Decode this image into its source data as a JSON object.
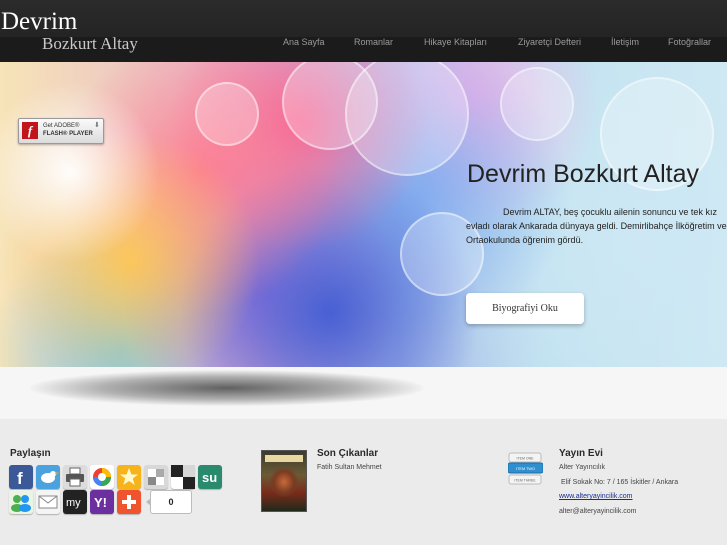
{
  "header": {
    "logo_line1": "Devrim",
    "logo_line2": "Bozkurt Altay",
    "nav": [
      "Ana Sayfa",
      "Romanlar",
      "Hikaye Kitapları",
      "Ziyaretçi Defteri",
      "İletişim",
      "Fotoğrallar"
    ]
  },
  "hero": {
    "flash_badge": {
      "line1": "Get ADOBE®",
      "line2": "FLASH® PLAYER"
    },
    "title": "Devrim Bozkurt Altay",
    "text": "Devrim ALTAY, beş çocuklu ailenin sonuncu ve tek kız evladı olarak Ankarada dünyaya geldi. Demirlibahçe İlköğretim ve Ortaokulunda öğrenim gördü.",
    "button": "Biyografiyi Oku"
  },
  "footer": {
    "share": {
      "title": "Paylaşın",
      "icons": [
        "facebook-icon",
        "twitter-icon",
        "print-icon",
        "google-icon",
        "favorites-icon",
        "delicious-icon",
        "digg-icon",
        "stumbleupon-icon",
        "messenger-icon",
        "email-icon",
        "myspace-icon",
        "yahoo-icon",
        "more-icon"
      ],
      "count": "0"
    },
    "latest": {
      "title": "Son Çıkanlar",
      "book": "Fatih Sultan Mehmet"
    },
    "publisher": {
      "title": "Yayın Evi",
      "name": "Alter Yayıncılık",
      "address": "Elif Sokak No: 7 / 165  İskitler / Ankara",
      "website": "www.alteryayincilik.com",
      "email": "alter@alteryayincilik.com",
      "logo_items": [
        "ITEM ONE",
        "ITEM TWO",
        "ITEM THREE"
      ]
    }
  }
}
